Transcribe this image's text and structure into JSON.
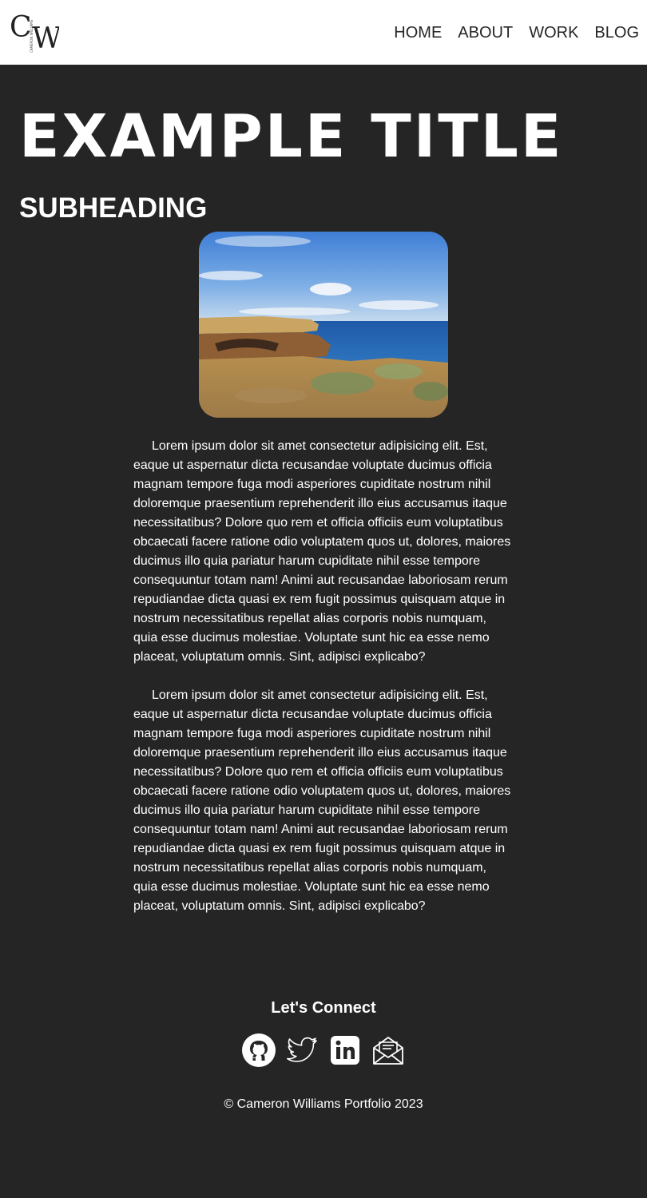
{
  "header": {
    "logo": {
      "letters": "CW",
      "vertical_text": "CAMERON WILLIAMS",
      "icon": "cw-logo"
    },
    "nav": [
      {
        "label": "HOME"
      },
      {
        "label": "ABOUT"
      },
      {
        "label": "WORK"
      },
      {
        "label": "BLOG"
      }
    ]
  },
  "hero": {
    "title": "EXAMPLE TITLE",
    "subheading": "SUBHEADING",
    "image": {
      "description_icon": "coastal-cliff-photo"
    }
  },
  "article": {
    "paragraphs": [
      "Lorem ipsum dolor sit amet consectetur adipisicing elit. Est, eaque ut aspernatur dicta recusandae voluptate ducimus officia magnam tempore fuga modi asperiores cupiditate nostrum nihil doloremque praesentium reprehenderit illo eius accusamus itaque necessitatibus? Dolore quo rem et officia officiis eum voluptatibus obcaecati facere ratione odio voluptatem quos ut, dolores, maiores ducimus illo quia pariatur harum cupiditate nihil esse tempore consequuntur totam nam! Animi aut recusandae laboriosam rerum repudiandae dicta quasi ex rem fugit possimus quisquam atque in nostrum necessitatibus repellat alias corporis nobis numquam, quia esse ducimus molestiae. Voluptate sunt hic ea esse nemo placeat, voluptatum omnis. Sint, adipisci explicabo?",
      "Lorem ipsum dolor sit amet consectetur adipisicing elit. Est, eaque ut aspernatur dicta recusandae voluptate ducimus officia magnam tempore fuga modi asperiores cupiditate nostrum nihil doloremque praesentium reprehenderit illo eius accusamus itaque necessitatibus? Dolore quo rem et officia officiis eum voluptatibus obcaecati facere ratione odio voluptatem quos ut, dolores, maiores ducimus illo quia pariatur harum cupiditate nihil esse tempore consequuntur totam nam! Animi aut recusandae laboriosam rerum repudiandae dicta quasi ex rem fugit possimus quisquam atque in nostrum necessitatibus repellat alias corporis nobis numquam, quia esse ducimus molestiae. Voluptate sunt hic ea esse nemo placeat, voluptatum omnis. Sint, adipisci explicabo?"
    ]
  },
  "footer": {
    "connect_heading": "Let's Connect",
    "social": [
      {
        "icon": "github-icon"
      },
      {
        "icon": "twitter-icon"
      },
      {
        "icon": "linkedin-icon"
      },
      {
        "icon": "email-icon"
      }
    ],
    "copyright": "© Cameron Williams Portfolio 2023"
  },
  "colors": {
    "background": "#252525",
    "header_background": "#ffffff",
    "nav_text": "#262626",
    "text": "#ffffff"
  }
}
